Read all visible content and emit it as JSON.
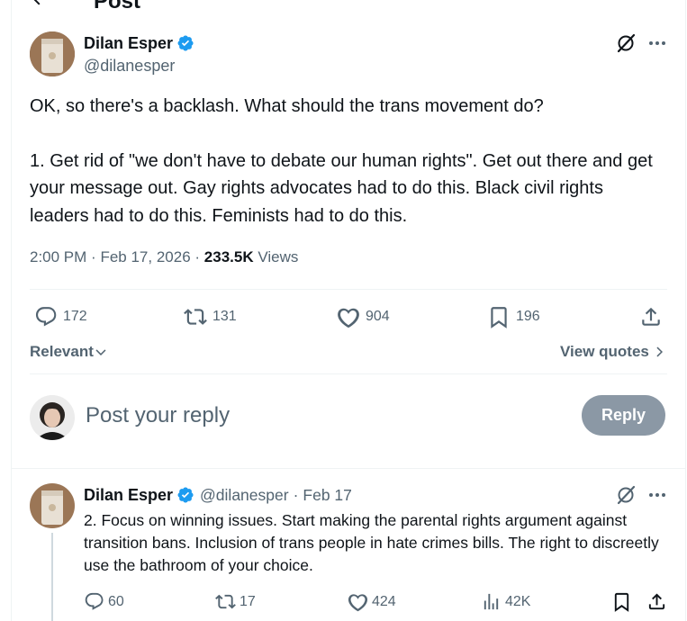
{
  "header": {
    "title": "Post"
  },
  "post": {
    "author_name": "Dilan Esper",
    "author_handle": "@dilanesper",
    "text_paragraphs": [
      "OK, so there's a backlash. What should the trans movement do?",
      "1. Get rid of \"we don't have to debate our human rights\". Get out there and get your message out. Gay rights advocates had to do this. Black civil rights leaders had to do this. Feminists had to do this."
    ],
    "time": "2:00 PM",
    "date": "Feb 17, 2026",
    "separator": "·",
    "views_count": "233.5K",
    "views_label": "Views",
    "replies": "172",
    "reposts": "131",
    "likes": "904",
    "bookmarks": "196"
  },
  "sort": {
    "relevant_label": "Relevant",
    "view_quotes_label": "View quotes"
  },
  "composer": {
    "placeholder": "Post your reply",
    "reply_button": "Reply"
  },
  "reply": {
    "author_name": "Dilan Esper",
    "author_handle": "@dilanesper",
    "separator": "·",
    "date": "Feb 17",
    "text": "2. Focus on winning issues. Start making the parental rights argument against transition bans. Inclusion of trans people in hate crimes bills. The right to discreetly use the bathroom of your choice.",
    "replies": "60",
    "reposts": "17",
    "likes": "424",
    "views": "42K"
  },
  "icons": {
    "back": "arrow-left-icon",
    "grok": "grok-icon",
    "more": "more-dots-icon",
    "verified": "verified-badge-icon",
    "reply": "reply-icon",
    "repost": "repost-icon",
    "like": "heart-icon",
    "bookmark": "bookmark-icon",
    "share": "share-icon",
    "views": "views-chart-icon",
    "chevron_down": "chevron-down-icon",
    "chevron_right": "chevron-right-icon"
  },
  "colors": {
    "text_primary": "#0f1419",
    "text_secondary": "#536471",
    "verified_blue": "#1d9bf0",
    "reply_button_disabled": "#8b98a5",
    "divider": "#eff3f4"
  }
}
